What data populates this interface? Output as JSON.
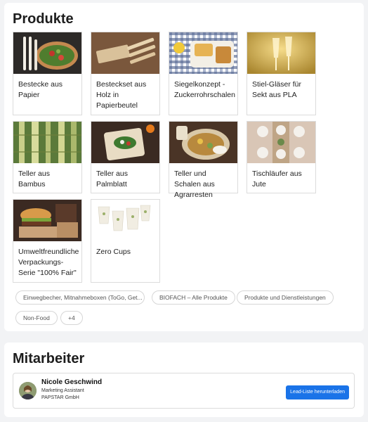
{
  "products": {
    "title": "Produkte",
    "items": [
      {
        "label": "Bestecke aus Papier",
        "image": "paper-cutlery-photo"
      },
      {
        "label": "Besteckset aus Holz in Papierbeutel",
        "image": "wood-cutlery-photo"
      },
      {
        "label": "Siegelkonzept - Zuckerrohrschalen",
        "image": "sugarcane-tray-photo"
      },
      {
        "label": "Stiel-Gläser für Sekt aus PLA",
        "image": "champagne-glasses-photo"
      },
      {
        "label": "Teller aus Bambus",
        "image": "bamboo-photo"
      },
      {
        "label": "Teller aus Palmblatt",
        "image": "palm-leaf-plate-photo"
      },
      {
        "label": "Teller und Schalen aus Agrarresten",
        "image": "agri-bowls-photo"
      },
      {
        "label": "Tischläufer aus Jute",
        "image": "jute-table-runner-photo"
      },
      {
        "label": "Umweltfreundliche Verpackungs-Serie \"100% Fair\"",
        "image": "burger-packaging-photo"
      },
      {
        "label": "Zero Cups",
        "image": "paper-cups-photo"
      }
    ],
    "tags": [
      "Einwegbecher, Mitnahmeboxen (ToGo, Get...",
      "BIOFACH – Alle Produkte",
      "Produkte und Dienstleistungen",
      "Non-Food",
      "+4"
    ]
  },
  "employees": {
    "title": "Mitarbeiter",
    "person": {
      "name": "Nicole Geschwind",
      "role": "Marketing Assistant",
      "company": "PAPSTAR GmbH",
      "button_label": "Lead-Liste herunterladen"
    }
  },
  "colors": {
    "accent": "#1a73e8",
    "card_bg": "#ffffff",
    "page_bg": "#f2f3f5"
  }
}
